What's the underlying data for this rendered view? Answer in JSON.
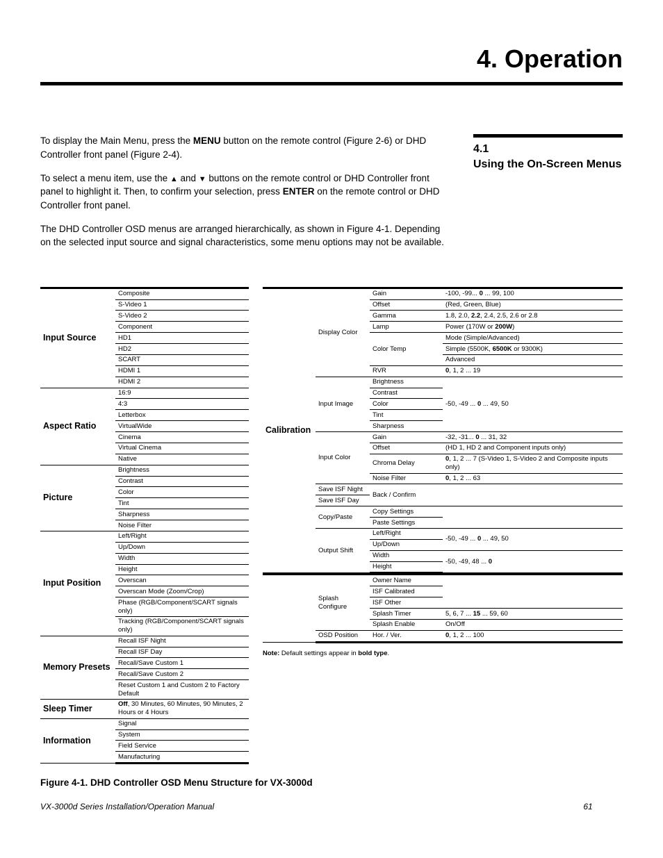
{
  "chapter_title": "4. Operation",
  "section": {
    "num": "4.1",
    "title": "Using the On-Screen Menus"
  },
  "intro": {
    "p1a": "To display the Main Menu, press the ",
    "p1_bold": "MENU",
    "p1b": " button on the remote control (Figure 2-6) or DHD Controller front panel (Figure 2-4).",
    "p2a": "To select a menu item, use the ",
    "p2b": " and ",
    "p2c": " buttons on the remote control or DHD Controller front panel to highlight it. Then, to confirm your selection, press ",
    "p2_bold": "ENTER",
    "p2d": " on the remote control or DHD Controller front panel.",
    "p3": "The DHD Controller OSD menus are arranged hierarchically, as shown in Figure 4-1. Depending on the selected input source and signal characteristics, some menu options may not be available."
  },
  "left_menu": {
    "input_source": {
      "header": "Input Source",
      "items": [
        "Composite",
        "S-Video 1",
        "S-Video 2",
        "Component",
        "HD1",
        "HD2",
        "SCART",
        "HDMI 1",
        "HDMI 2"
      ]
    },
    "aspect_ratio": {
      "header": "Aspect Ratio",
      "items": [
        "16:9",
        "4:3",
        "Letterbox",
        "VirtualWide",
        "Cinema",
        "Virtual Cinema",
        "Native"
      ]
    },
    "picture": {
      "header": "Picture",
      "items": [
        "Brightness",
        "Contrast",
        "Color",
        "Tint",
        "Sharpness",
        "Noise Filter"
      ]
    },
    "input_position": {
      "header": "Input Position",
      "items": [
        "Left/Right",
        "Up/Down",
        "Width",
        "Height",
        "Overscan",
        "Overscan Mode (Zoom/Crop)",
        "Phase (RGB/Component/SCART signals only)",
        "Tracking (RGB/Component/SCART signals only)"
      ]
    },
    "memory_presets": {
      "header": "Memory Presets",
      "items": [
        "Recall ISF Night",
        "Recall ISF Day",
        "Recall/Save Custom 1",
        "Recall/Save Custom 2",
        "Reset Custom 1 and Custom 2 to Factory Default"
      ]
    },
    "sleep_timer": {
      "header": "Sleep Timer",
      "value_prefix": "Off",
      "value_rest": ", 30 Minutes, 60 Minutes, 90 Minutes, 2 Hours or 4 Hours"
    },
    "information": {
      "header": "Information",
      "items": [
        "Signal",
        "System",
        "Field Service",
        "Manufacturing"
      ]
    }
  },
  "calibration": {
    "header": "Calibration",
    "display_color": {
      "label": "Display Color",
      "gain": {
        "label": "Gain",
        "range_a": "-100, -99... ",
        "range_b": "0",
        "range_c": " ... 99, 100"
      },
      "offset": {
        "label": "Offset",
        "range": "(Red, Green, Blue)"
      },
      "gamma": {
        "label": "Gamma",
        "range_a": "1.8, 2.0, ",
        "range_b": "2.2",
        "range_c": ", 2.4, 2.5, 2.6 or 2.8"
      },
      "lamp": {
        "label": "Lamp",
        "range_a": "Power (170W or ",
        "range_b": "200W",
        "range_c": ")"
      },
      "color_temp": {
        "label": "Color Temp",
        "mode": "Mode (Simple/Advanced)",
        "simple_a": "Simple (5500K, ",
        "simple_b": "6500K",
        "simple_c": " or 9300K)",
        "advanced": "Advanced"
      },
      "rvr": {
        "label": "RVR",
        "range_a": "0",
        "range_b": ", 1, 2 ... 19"
      }
    },
    "input_image": {
      "label": "Input Image",
      "items": [
        "Brightness",
        "Contrast",
        "Color",
        "Tint",
        "Sharpness"
      ],
      "range_a": "-50, -49 ... ",
      "range_b": "0",
      "range_c": " ... 49, 50"
    },
    "input_color": {
      "label": "Input Color",
      "gain": {
        "label": "Gain",
        "range_a": "-32, -31... ",
        "range_b": "0",
        "range_c": " ... 31, 32"
      },
      "offset": {
        "label": "Offset",
        "range": "(HD 1, HD 2 and Component inputs only)"
      },
      "chroma": {
        "label": "Chroma Delay",
        "range_a": "0",
        "range_b": ", 1, 2 ... 7 (S-Video 1, S-Video 2 and Composite inputs only)"
      },
      "noise": {
        "label": "Noise Filter",
        "range_a": "0",
        "range_b": ", 1, 2 ... 63"
      }
    },
    "save_isf": {
      "night": "Save ISF Night",
      "day": "Save ISF Day",
      "back": "Back / Confirm"
    },
    "copy_paste": {
      "label": "Copy/Paste",
      "copy": "Copy Settings",
      "paste": "Paste Settings"
    },
    "output_shift": {
      "label": "Output Shift",
      "lr": "Left/Right",
      "ud": "Up/Down",
      "w": "Width",
      "h": "Height",
      "range1_a": "-50, -49 ... ",
      "range1_b": "0",
      "range1_c": " ... 49, 50",
      "range2_a": "-50, -49, 48 ... ",
      "range2_b": "0"
    },
    "splash": {
      "label": "Splash Configure",
      "owner": "Owner Name",
      "isfcal": "ISF Calibrated",
      "isfother": "ISF Other",
      "timer": {
        "label": "Splash Timer",
        "range_a": "5, 6, 7 ... ",
        "range_b": "15",
        "range_c": " ... 59, 60"
      },
      "enable": {
        "label": "Splash Enable",
        "range": "On/Off"
      }
    },
    "osd": {
      "label": "OSD Position",
      "hv": "Hor. / Ver.",
      "range_a": "0",
      "range_b": ", 1, 2 ... 100"
    }
  },
  "note_prefix": "Note:",
  "note_body": " Default settings appear in ",
  "note_bold": "bold type",
  "note_period": ".",
  "figure_caption": "Figure 4-1. DHD Controller OSD Menu Structure for VX-3000d",
  "footer": {
    "title": "VX-3000d Series Installation/Operation Manual",
    "page": "61"
  }
}
